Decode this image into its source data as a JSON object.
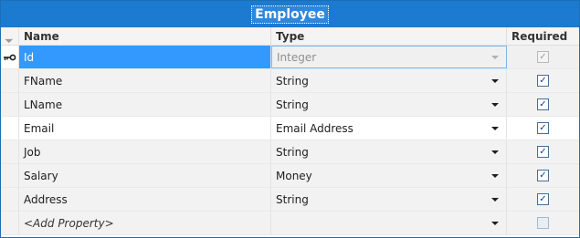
{
  "title": "Employee",
  "columns": {
    "name": "Name",
    "type": "Type",
    "required": "Required"
  },
  "rows": [
    {
      "name": "Id",
      "type": "Integer",
      "required": true,
      "key": true,
      "selected": true
    },
    {
      "name": "FName",
      "type": "String",
      "required": true
    },
    {
      "name": "LName",
      "type": "String",
      "required": true
    },
    {
      "name": "Email",
      "type": "Email Address",
      "required": true
    },
    {
      "name": "Job",
      "type": "String",
      "required": true
    },
    {
      "name": "Salary",
      "type": "Money",
      "required": true
    },
    {
      "name": "Address",
      "type": "String",
      "required": true
    }
  ],
  "add_row": {
    "name": "<Add Property>",
    "required": false
  },
  "icons": {
    "key": "key-icon",
    "dropdown": "chevron-down-icon",
    "check": "checkmark-icon"
  },
  "colors": {
    "title_bar": "#1c7ad0",
    "selection": "#3399ff"
  }
}
